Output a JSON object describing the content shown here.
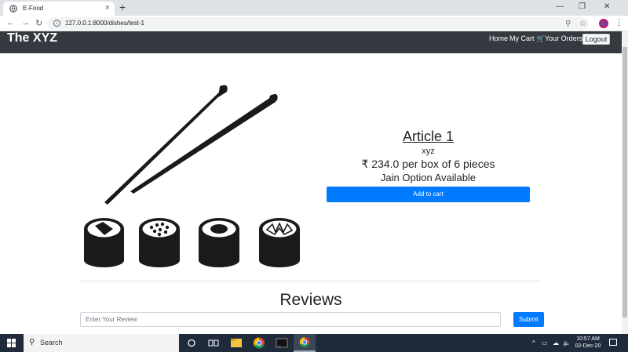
{
  "browser": {
    "tab_title": "E-Food",
    "url": "127.0.0.1:8000/dishes/test-1",
    "icons": [
      "chrome-icon",
      "close-icon",
      "new-tab-icon",
      "minimize-icon",
      "maximize-icon",
      "window-close-icon",
      "back-icon",
      "forward-icon",
      "reload-icon",
      "info-icon",
      "zoom-icon",
      "star-icon",
      "profile-avatar",
      "menu-icon"
    ]
  },
  "navbar": {
    "brand": "The XYZ",
    "home": "Home",
    "cart": "My Cart 🛒",
    "orders": "Your Orders",
    "logout": "Logout"
  },
  "dish": {
    "title": "Article 1",
    "subtitle": "xyz",
    "price": "₹ 234.0 per box of 6 pieces",
    "option": "Jain Option Available",
    "add_to_cart": "Add to cart"
  },
  "reviews": {
    "title": "Reviews",
    "placeholder": "Enter Your Review",
    "submit": "Submit"
  },
  "taskbar": {
    "search": "Search",
    "time": "10:57 AM",
    "date": "02-Dec-20"
  },
  "colors": {
    "navbar_bg": "#343a40",
    "primary": "#007bff",
    "taskbar_bg": "#1f2a3a"
  }
}
